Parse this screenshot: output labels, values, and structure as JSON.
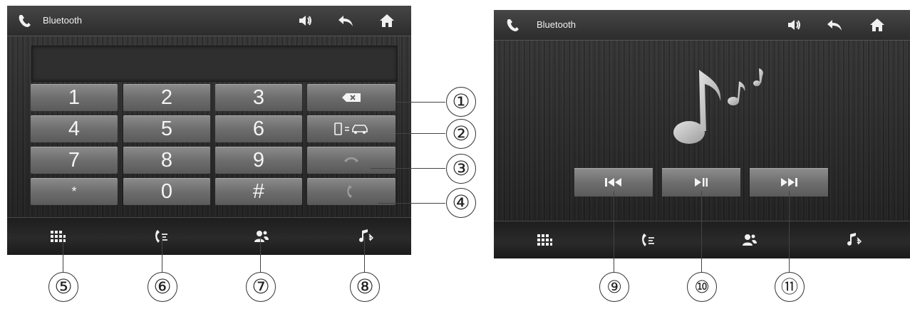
{
  "left_screen": {
    "title": "Bluetooth",
    "top_icons": [
      "phone-icon",
      "volume-icon",
      "back-icon",
      "home-icon"
    ],
    "dialpad": [
      "1",
      "2",
      "3",
      "4",
      "5",
      "6",
      "7",
      "8",
      "9",
      "*",
      "0",
      "#"
    ],
    "function_keys": [
      "backspace-icon",
      "phone-to-car-transfer-icon",
      "answer-call-icon",
      "hang-up-icon"
    ],
    "bottom_nav": [
      "dialpad-icon",
      "call-log-icon",
      "contacts-icon",
      "bluetooth-music-icon"
    ]
  },
  "right_screen": {
    "title": "Bluetooth",
    "top_icons": [
      "phone-icon",
      "volume-icon",
      "back-icon",
      "home-icon"
    ],
    "art": "music-notes-icon",
    "media_controls": [
      "previous-track-icon",
      "play-pause-icon",
      "next-track-icon"
    ],
    "bottom_nav": [
      "dialpad-icon",
      "call-log-icon",
      "contacts-icon",
      "bluetooth-music-icon"
    ]
  },
  "callouts": [
    "①",
    "②",
    "③",
    "④",
    "⑤",
    "⑥",
    "⑦",
    "⑧",
    "⑨",
    "⑩",
    "⑪"
  ]
}
